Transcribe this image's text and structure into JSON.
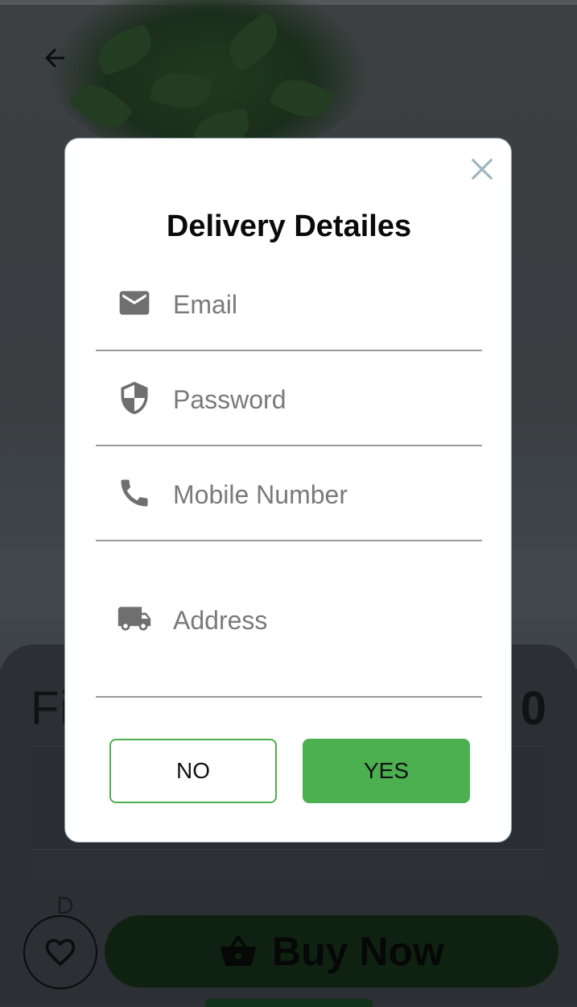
{
  "background": {
    "product_title_visible": "Fi",
    "product_price_visible": "0",
    "description_visible": "D",
    "buy_button_label": "Buy Now",
    "icons": {
      "back": "arrow-left-icon",
      "favorite": "heart-icon",
      "basket": "shopping-basket-icon"
    }
  },
  "dialog": {
    "title": "Delivery Detailes",
    "close_icon": "close-icon",
    "fields": {
      "email": {
        "placeholder": "Email",
        "icon": "email-icon"
      },
      "password": {
        "placeholder": "Password",
        "icon": "shield-icon"
      },
      "mobile": {
        "placeholder": "Mobile Number",
        "icon": "phone-icon"
      },
      "address": {
        "placeholder": "Address",
        "icon": "truck-icon"
      }
    },
    "buttons": {
      "no": "NO",
      "yes": "YES"
    }
  },
  "colors": {
    "accent_green": "#4caf50",
    "overlay": "#2e3236",
    "icon_gray": "#6f6f6f"
  }
}
